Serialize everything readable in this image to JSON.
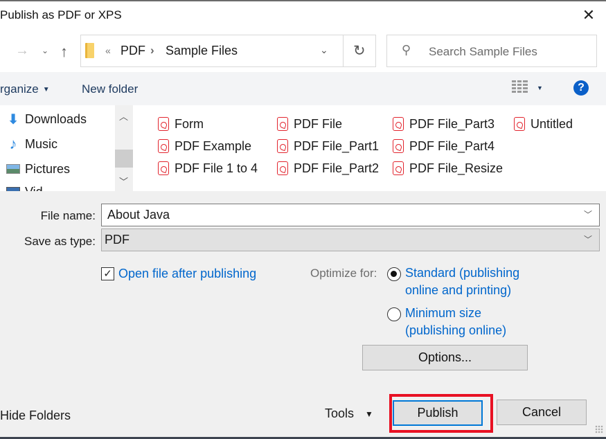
{
  "window": {
    "title": "Publish as PDF or XPS",
    "close_icon": "close-icon"
  },
  "navigation": {
    "back_icon": "arrow-right-icon",
    "recent_icon": "chevron-down-icon",
    "up_icon": "arrow-up-icon",
    "folder_icon": "folder-icon",
    "overflow": "«",
    "breadcrumb": [
      "PDF",
      "Sample Files"
    ],
    "separator": "›",
    "refresh_icon": "refresh-icon",
    "search_placeholder": "Search Sample Files"
  },
  "toolbar": {
    "organize_label": "rganize",
    "new_folder_label": "New folder",
    "view_icon": "view-options-icon",
    "help_icon": "help-icon"
  },
  "sidebar": {
    "items": [
      {
        "label": "Downloads",
        "icon": "download-icon"
      },
      {
        "label": "Music",
        "icon": "music-icon"
      },
      {
        "label": "Pictures",
        "icon": "pictures-icon"
      },
      {
        "label": "Vid",
        "icon": "videos-icon"
      }
    ]
  },
  "files": [
    "Form",
    "PDF Example",
    "PDF File 1 to 4",
    "PDF File",
    "PDF File_Part1",
    "PDF File_Part2",
    "PDF File_Part3",
    "PDF File_Part4",
    "PDF File_Resize",
    "Untitled"
  ],
  "form": {
    "file_name_label": "File name:",
    "file_name_value": "About Java",
    "save_type_label": "Save as type:",
    "save_type_value": "PDF",
    "open_after_label": "Open file after publishing",
    "open_after_checked": true,
    "optimize_label": "Optimize for:",
    "optimize_options": [
      {
        "line1": "Standard (publishing",
        "line2": "online and printing)",
        "selected": true
      },
      {
        "line1": "Minimum size",
        "line2": "(publishing online)",
        "selected": false
      }
    ],
    "options_button": "Options..."
  },
  "footer": {
    "hide_folders": "Hide Folders",
    "tools_label": "Tools",
    "publish_button": "Publish",
    "cancel_button": "Cancel"
  },
  "colors": {
    "accent": "#0078d7",
    "link_blue": "#0066cc",
    "highlight_red": "#e81123",
    "pdf_red": "#e2242d"
  }
}
